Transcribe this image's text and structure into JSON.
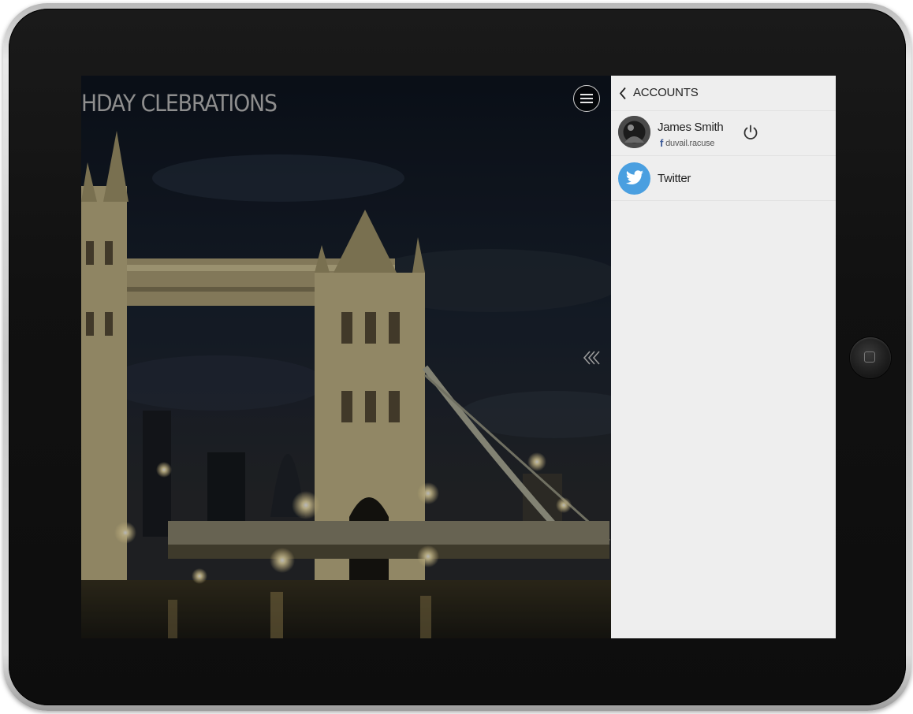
{
  "app": {
    "page_title": "HDAY CLEBRATIONS"
  },
  "icons": {
    "menu": "hamburger-menu-icon",
    "collapse": "double-chevron-left-icon",
    "back": "chevron-left-icon",
    "power": "power-icon",
    "facebook": "facebook-icon",
    "twitter": "twitter-bird-icon",
    "home": "home-button"
  },
  "accounts_panel": {
    "title": "ACCOUNTS",
    "accounts": [
      {
        "name": "James Smith",
        "network": "facebook",
        "network_glyph": "f",
        "handle": "duvail.racuse",
        "connected": true
      },
      {
        "name": "Twitter",
        "network": "twitter",
        "connected": false
      }
    ]
  },
  "colors": {
    "panel_background": "#eeeeee",
    "twitter_blue": "#4a9fe0",
    "facebook_blue": "#3b5998",
    "title_gray": "#8e8e8e"
  }
}
